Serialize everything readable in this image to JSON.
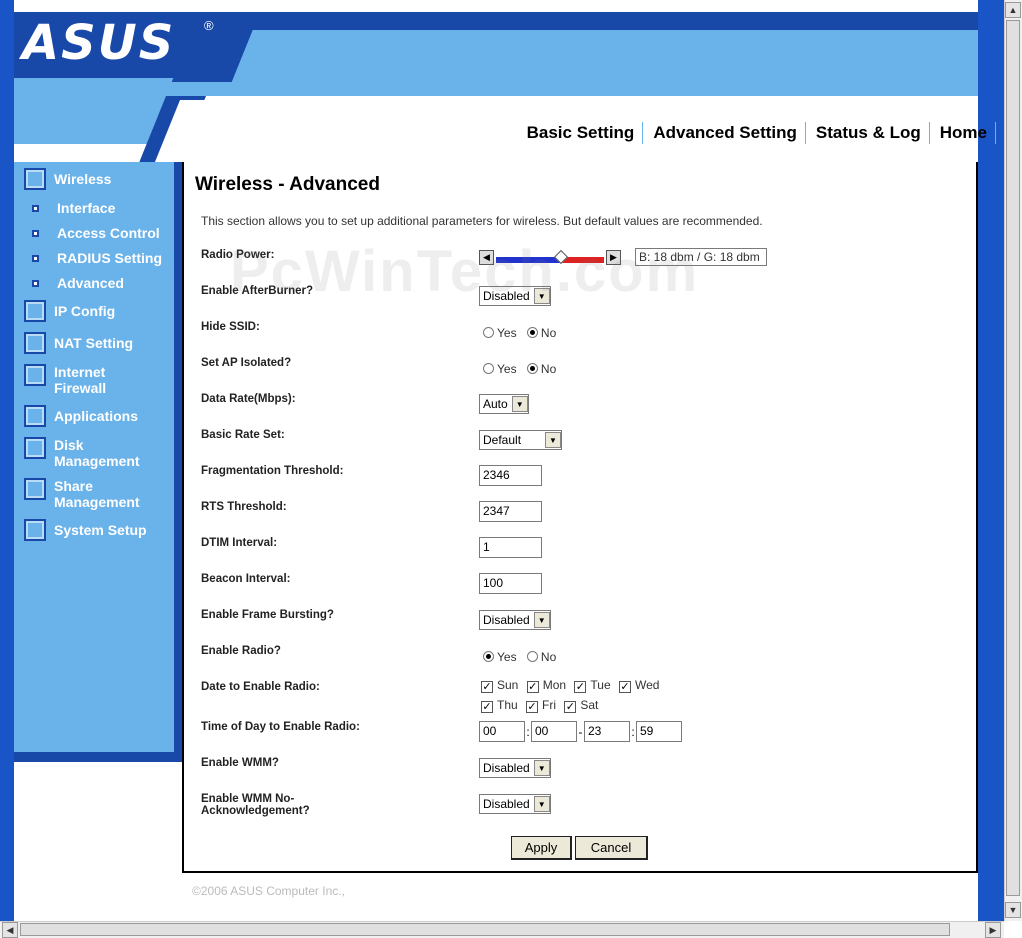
{
  "brand": {
    "logo": "ASUS",
    "registered": "®"
  },
  "topnav": [
    "Basic Setting",
    "Advanced Setting",
    "Status & Log",
    "Home"
  ],
  "sidebar": {
    "main": [
      "Wireless",
      "IP Config",
      "NAT Setting",
      "Internet Firewall",
      "Applications",
      "Disk Management",
      "Share Management",
      "System Setup"
    ],
    "sub": [
      "Interface",
      "Access Control",
      "RADIUS Setting",
      "Advanced"
    ]
  },
  "page": {
    "title": "Wireless - Advanced",
    "intro": "This section allows you to set up additional parameters for wireless. But default values are recommended.",
    "watermark": "PcWinTech.com"
  },
  "form": {
    "radio_power": {
      "label": "Radio Power:",
      "readout": "B: 18 dbm / G: 18 dbm"
    },
    "afterburner": {
      "label": "Enable AfterBurner?",
      "value": "Disabled"
    },
    "hide_ssid": {
      "label": "Hide SSID:",
      "yes": "Yes",
      "no": "No",
      "selected": "No"
    },
    "ap_isolated": {
      "label": "Set AP Isolated?",
      "yes": "Yes",
      "no": "No",
      "selected": "No"
    },
    "data_rate": {
      "label": "Data Rate(Mbps):",
      "value": "Auto"
    },
    "basic_rate": {
      "label": "Basic Rate Set:",
      "value": "Default"
    },
    "frag": {
      "label": "Fragmentation Threshold:",
      "value": "2346"
    },
    "rts": {
      "label": "RTS Threshold:",
      "value": "2347"
    },
    "dtim": {
      "label": "DTIM Interval:",
      "value": "1"
    },
    "beacon": {
      "label": "Beacon Interval:",
      "value": "100"
    },
    "frame_burst": {
      "label": "Enable Frame Bursting?",
      "value": "Disabled"
    },
    "enable_radio": {
      "label": "Enable Radio?",
      "yes": "Yes",
      "no": "No",
      "selected": "Yes"
    },
    "radio_days": {
      "label": "Date to Enable Radio:",
      "days": [
        "Sun",
        "Mon",
        "Tue",
        "Wed",
        "Thu",
        "Fri",
        "Sat"
      ]
    },
    "radio_time": {
      "label": "Time of Day to Enable Radio:",
      "start_h": "00",
      "start_m": "00",
      "end_h": "23",
      "end_m": "59",
      "sep1": ":",
      "dash": "-",
      "sep2": ":"
    },
    "wmm": {
      "label": "Enable WMM?",
      "value": "Disabled"
    },
    "wmm_noack": {
      "label_line1": "Enable WMM No-",
      "label_line2": "Acknowledgement?",
      "value": "Disabled"
    }
  },
  "buttons": {
    "apply": "Apply",
    "cancel": "Cancel"
  },
  "footer": "©2006 ASUS Computer Inc.,",
  "colors": {
    "navy": "#1848a8",
    "light_blue": "#6ab2ea",
    "frame_blue": "#1a55c8"
  }
}
